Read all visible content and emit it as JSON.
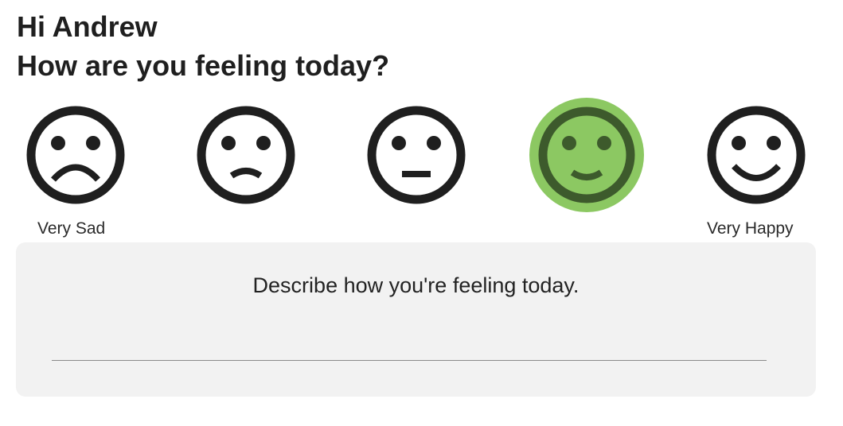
{
  "header": {
    "greeting": "Hi Andrew",
    "question": "How are you feeling today?"
  },
  "moods": [
    {
      "id": "very-sad",
      "label": "Very Sad",
      "icon": "very-sad-face-icon",
      "selected": false
    },
    {
      "id": "sad",
      "label": "",
      "icon": "sad-face-icon",
      "selected": false
    },
    {
      "id": "neutral",
      "label": "",
      "icon": "neutral-face-icon",
      "selected": false
    },
    {
      "id": "happy",
      "label": "",
      "icon": "happy-face-icon",
      "selected": true
    },
    {
      "id": "very-happy",
      "label": "Very Happy",
      "icon": "very-happy-face-icon",
      "selected": false
    }
  ],
  "description": {
    "prompt": "Describe how you're feeling today.",
    "value": "",
    "placeholder": ""
  },
  "colors": {
    "selected_highlight": "#8cc862",
    "selected_face": "#3d5a2c",
    "face_stroke": "#1f1f1f",
    "panel_background": "#f2f2f2"
  }
}
